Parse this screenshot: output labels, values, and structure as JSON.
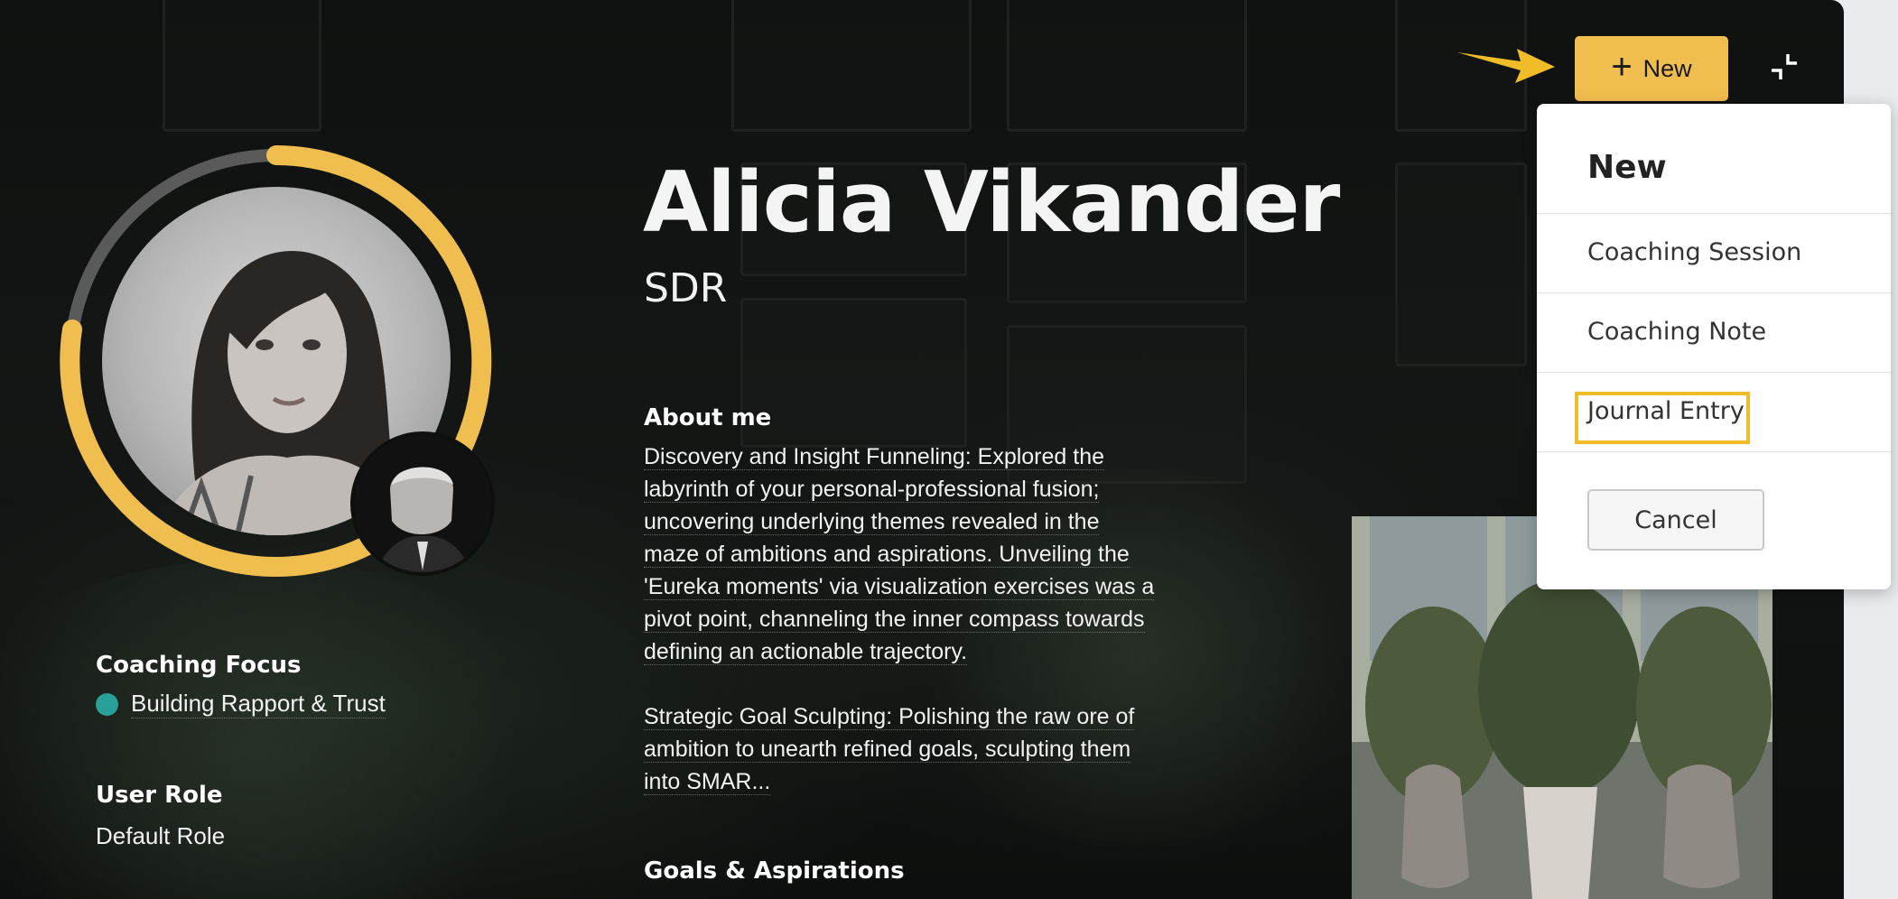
{
  "profile": {
    "name": "Alicia Vikander",
    "title": "SDR"
  },
  "about": {
    "heading": "About me",
    "lines": [
      "Discovery and Insight Funneling: Explored the",
      "labyrinth of your personal-professional fusion;",
      "uncovering underlying themes revealed in the",
      "maze of ambitions and aspirations. Unveiling the",
      "'Eureka moments' via visualization exercises was a",
      "pivot point, channeling the inner compass towards",
      "defining an actionable trajectory.",
      "",
      "Strategic Goal Sculpting: Polishing the raw ore of",
      "ambition to unearth refined goals, sculpting them",
      "into SMAR..."
    ]
  },
  "goals": {
    "heading": "Goals & Aspirations"
  },
  "coaching_focus": {
    "heading": "Coaching Focus",
    "item": "Building Rapport & Trust",
    "dot_color": "#2aa198"
  },
  "user_role": {
    "heading": "User Role",
    "value": "Default Role"
  },
  "toolbar": {
    "new_label": "New"
  },
  "new_menu": {
    "heading": "New",
    "items": [
      "Coaching Session",
      "Coaching Note",
      "Journal Entry"
    ],
    "highlighted": "Journal Entry",
    "cancel_label": "Cancel"
  },
  "colors": {
    "accent": "#f0bd4f",
    "ring_track": "#5a5a5a",
    "highlight_box": "#f0bd29"
  },
  "icons": {
    "new": "plus-icon",
    "collapse": "collapse-icon",
    "pointer": "arrow-pointer-icon"
  }
}
